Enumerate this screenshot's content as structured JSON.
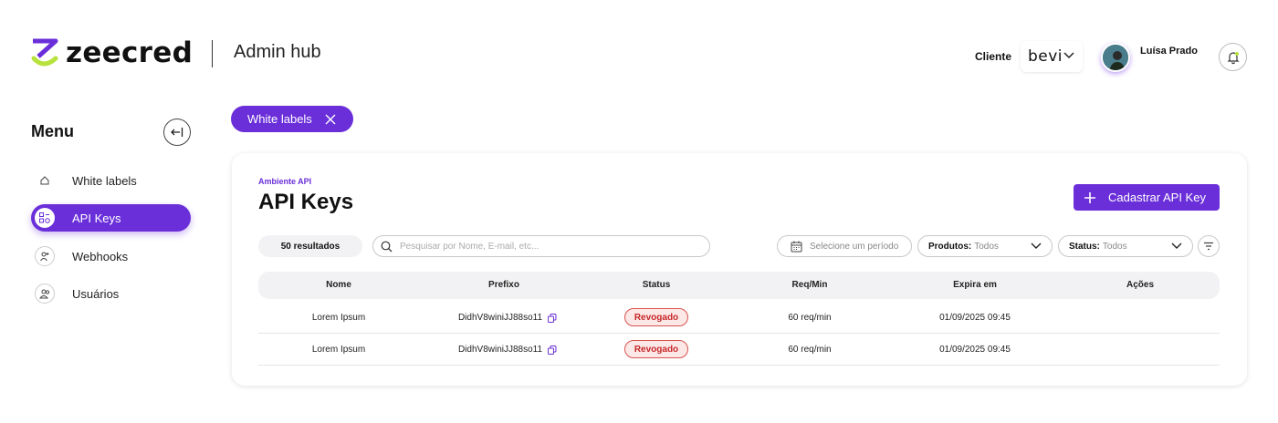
{
  "header": {
    "brand": "zeecred",
    "hub_title": "Admin hub",
    "client_label": "Cliente",
    "client_value": "bevi",
    "user_name": "Luísa Prado"
  },
  "sidebar": {
    "title": "Menu",
    "items": [
      {
        "label": "White labels",
        "icon": "home-icon",
        "active": false
      },
      {
        "label": "API Keys",
        "icon": "api-key-icon",
        "active": true
      },
      {
        "label": "Webhooks",
        "icon": "webhook-icon",
        "active": false
      },
      {
        "label": "Usuários",
        "icon": "users-icon",
        "active": false
      }
    ]
  },
  "chip": {
    "label": "White labels"
  },
  "card": {
    "env_label": "Ambiente API",
    "title": "API Keys",
    "primary_button": "Cadastrar API Key",
    "results": "50 resultados",
    "search_placeholder": "Pesquisar por Nome, E-mail, etc...",
    "period_placeholder": "Selecione um período",
    "filters": [
      {
        "key": "Produtos:",
        "value": "Todos"
      },
      {
        "key": "Status:",
        "value": "Todos"
      }
    ]
  },
  "table": {
    "columns": [
      "Nome",
      "Prefixo",
      "Status",
      "Req/Min",
      "Expira em",
      "Ações"
    ],
    "rows": [
      {
        "nome": "Lorem Ipsum",
        "prefixo": "DidhV8winiJJ88so11",
        "status": "Revogado",
        "req_min": "60 req/min",
        "expira": "01/09/2025 09:45"
      },
      {
        "nome": "Lorem Ipsum",
        "prefixo": "DidhV8winiJJ88so11",
        "status": "Revogado",
        "req_min": "60 req/min",
        "expira": "01/09/2025 09:45"
      }
    ]
  },
  "colors": {
    "accent": "#6a2fd9",
    "logo_lime": "#b7e23c",
    "danger": "#c62828",
    "danger_bg": "#fde8e8"
  }
}
